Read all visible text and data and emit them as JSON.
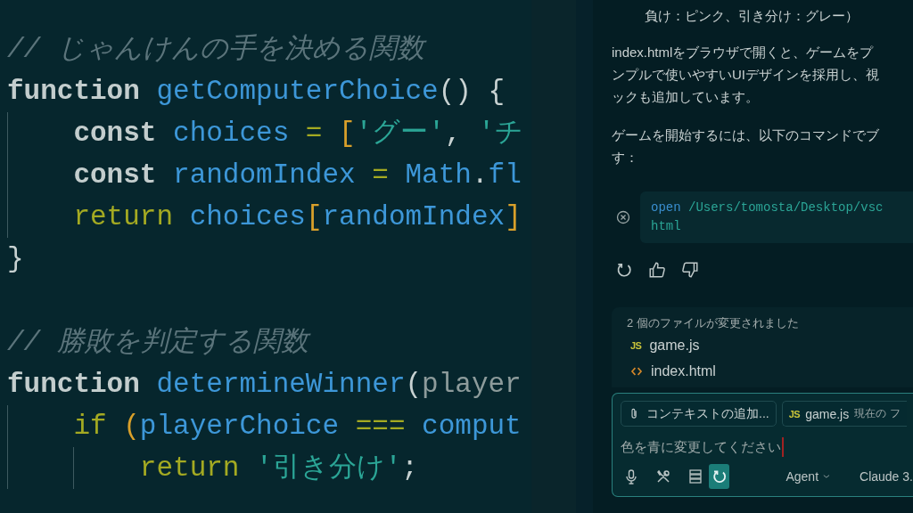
{
  "editor": {
    "blocks": [
      {
        "lines": [
          {
            "tokens": [
              {
                "kind": "comment",
                "text": "// じゃんけんの手を決める関数"
              }
            ]
          },
          {
            "tokens": [
              {
                "kind": "kw",
                "text": "function "
              },
              {
                "kind": "fn",
                "text": "getComputerChoice"
              },
              {
                "kind": "plain",
                "text": "() {"
              }
            ]
          },
          {
            "tokens": [
              {
                "kind": "kw",
                "text": "    const "
              },
              {
                "kind": "var",
                "text": "choices "
              },
              {
                "kind": "op",
                "text": "= "
              },
              {
                "kind": "br",
                "text": "["
              },
              {
                "kind": "str",
                "text": "'グー'"
              },
              {
                "kind": "plain",
                "text": ", "
              },
              {
                "kind": "str",
                "text": "'チ"
              }
            ]
          },
          {
            "tokens": [
              {
                "kind": "kw",
                "text": "    const "
              },
              {
                "kind": "var",
                "text": "randomIndex "
              },
              {
                "kind": "op",
                "text": "= "
              },
              {
                "kind": "var",
                "text": "Math"
              },
              {
                "kind": "plain",
                "text": "."
              },
              {
                "kind": "var",
                "text": "fl"
              }
            ]
          },
          {
            "tokens": [
              {
                "kind": "ctl",
                "text": "    return "
              },
              {
                "kind": "var",
                "text": "choices"
              },
              {
                "kind": "br",
                "text": "["
              },
              {
                "kind": "var",
                "text": "randomIndex"
              },
              {
                "kind": "br",
                "text": "]"
              }
            ]
          },
          {
            "tokens": [
              {
                "kind": "plain",
                "text": "}"
              }
            ]
          }
        ]
      },
      {
        "lines": [
          {
            "tokens": [
              {
                "kind": "comment",
                "text": "// 勝敗を判定する関数"
              }
            ]
          },
          {
            "tokens": [
              {
                "kind": "kw",
                "text": "function "
              },
              {
                "kind": "fn",
                "text": "determineWinner"
              },
              {
                "kind": "plain",
                "text": "("
              },
              {
                "kind": "param",
                "text": "player"
              }
            ]
          },
          {
            "tokens": [
              {
                "kind": "ctl",
                "text": "    if "
              },
              {
                "kind": "br",
                "text": "("
              },
              {
                "kind": "var",
                "text": "playerChoice "
              },
              {
                "kind": "op",
                "text": "=== "
              },
              {
                "kind": "var",
                "text": "comput"
              }
            ]
          },
          {
            "tokens": [
              {
                "kind": "ctl",
                "text": "        return "
              },
              {
                "kind": "str",
                "text": "'引き分け'"
              },
              {
                "kind": "plain",
                "text": ";"
              }
            ]
          }
        ]
      }
    ]
  },
  "chat": {
    "summary_tail": "負け：ピンク、引き分け：グレー）",
    "paragraphs": [
      {
        "lines": [
          "index.htmlをブラウザで開くと、ゲームをプ",
          "ンプルで使いやすいUIデザインを採用し、視",
          "ックも追加しています。"
        ]
      },
      {
        "lines": [
          "ゲームを開始するには、以下のコマンドでブ",
          "す："
        ]
      }
    ],
    "command": {
      "lines": [
        {
          "tokens": [
            {
              "kind": "cmd",
              "text": "open"
            },
            {
              "kind": "arg",
              "text": " /Users/tomosta/Desktop/vsc"
            }
          ]
        },
        {
          "tokens": [
            {
              "kind": "arg",
              "text": "html"
            }
          ]
        }
      ]
    },
    "feedback": [
      {
        "kind": "retry"
      },
      {
        "kind": "like"
      },
      {
        "kind": "dislike"
      }
    ],
    "changed_files": {
      "title": "2 個のファイルが変更されました",
      "files": [
        {
          "kind": "js",
          "badge": "JS",
          "name": "game.js"
        },
        {
          "kind": "html",
          "name": "index.html"
        }
      ]
    },
    "composer": {
      "chips": [
        {
          "kind": "attach",
          "label": "コンテキストの追加..."
        },
        {
          "kind": "file",
          "badge": "JS",
          "label": "game.js",
          "note": "現在の フ"
        }
      ],
      "value": "色を青に変更してください",
      "tools": [
        {
          "kind": "mic",
          "on": false
        },
        {
          "kind": "tools",
          "on": false
        },
        {
          "kind": "server",
          "on": false
        },
        {
          "kind": "refresh",
          "on": true
        }
      ],
      "mode": "Agent",
      "model": "Claude 3."
    }
  }
}
